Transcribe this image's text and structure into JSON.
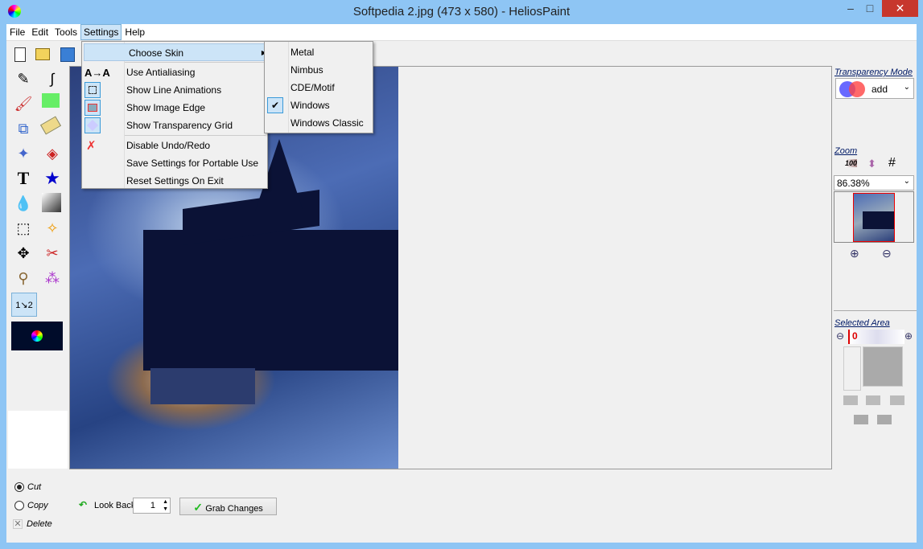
{
  "window": {
    "title": "Softpedia 2.jpg (473 x 580)  - HeliosPaint",
    "minimize": "–",
    "maximize": "□",
    "close": "✕"
  },
  "menubar": [
    "File",
    "Edit",
    "Tools",
    "Settings",
    "Help"
  ],
  "settings_menu": [
    {
      "label": "Choose Skin",
      "icon": "",
      "submenu": true
    },
    {
      "label": "Use Antialiasing",
      "icon": "antialias-icon"
    },
    {
      "label": "Show Line Animations",
      "icon": "line-animation-icon",
      "checked": true
    },
    {
      "label": "Show Image Edge",
      "icon": "image-edge-icon",
      "checked": true
    },
    {
      "label": "Show Transparency Grid",
      "icon": "transparency-grid-icon",
      "checked": true
    },
    {
      "label": "Disable Undo/Redo",
      "icon": "undo-disabled-icon"
    },
    {
      "label": "Save Settings for Portable Use",
      "icon": ""
    },
    {
      "label": "Reset Settings On Exit",
      "icon": ""
    }
  ],
  "skin_menu": [
    {
      "label": "Metal",
      "checked": false
    },
    {
      "label": "Nimbus",
      "checked": false
    },
    {
      "label": "CDE/Motif",
      "checked": false
    },
    {
      "label": "Windows",
      "checked": true
    },
    {
      "label": "Windows Classic",
      "checked": false
    }
  ],
  "right_panel": {
    "transparency_label": "Transparency Mode",
    "transparency_value": "add",
    "zoom_label": "Zoom",
    "zoom_value": "86.38%",
    "zoom_100": "100",
    "selected_label": "Selected Area",
    "selected_value": "0"
  },
  "bottom": {
    "cut": "Cut",
    "copy": "Copy",
    "delete": "Delete",
    "mode": "cut",
    "look_back_label": "Look Back",
    "look_back_value": "1",
    "grab_changes": "Grab Changes"
  },
  "tools": {
    "text_tool": "T"
  },
  "colors": {
    "accent": "#8ec5f4",
    "menu_highlight": "#cce4f7",
    "close": "#c7372d"
  }
}
